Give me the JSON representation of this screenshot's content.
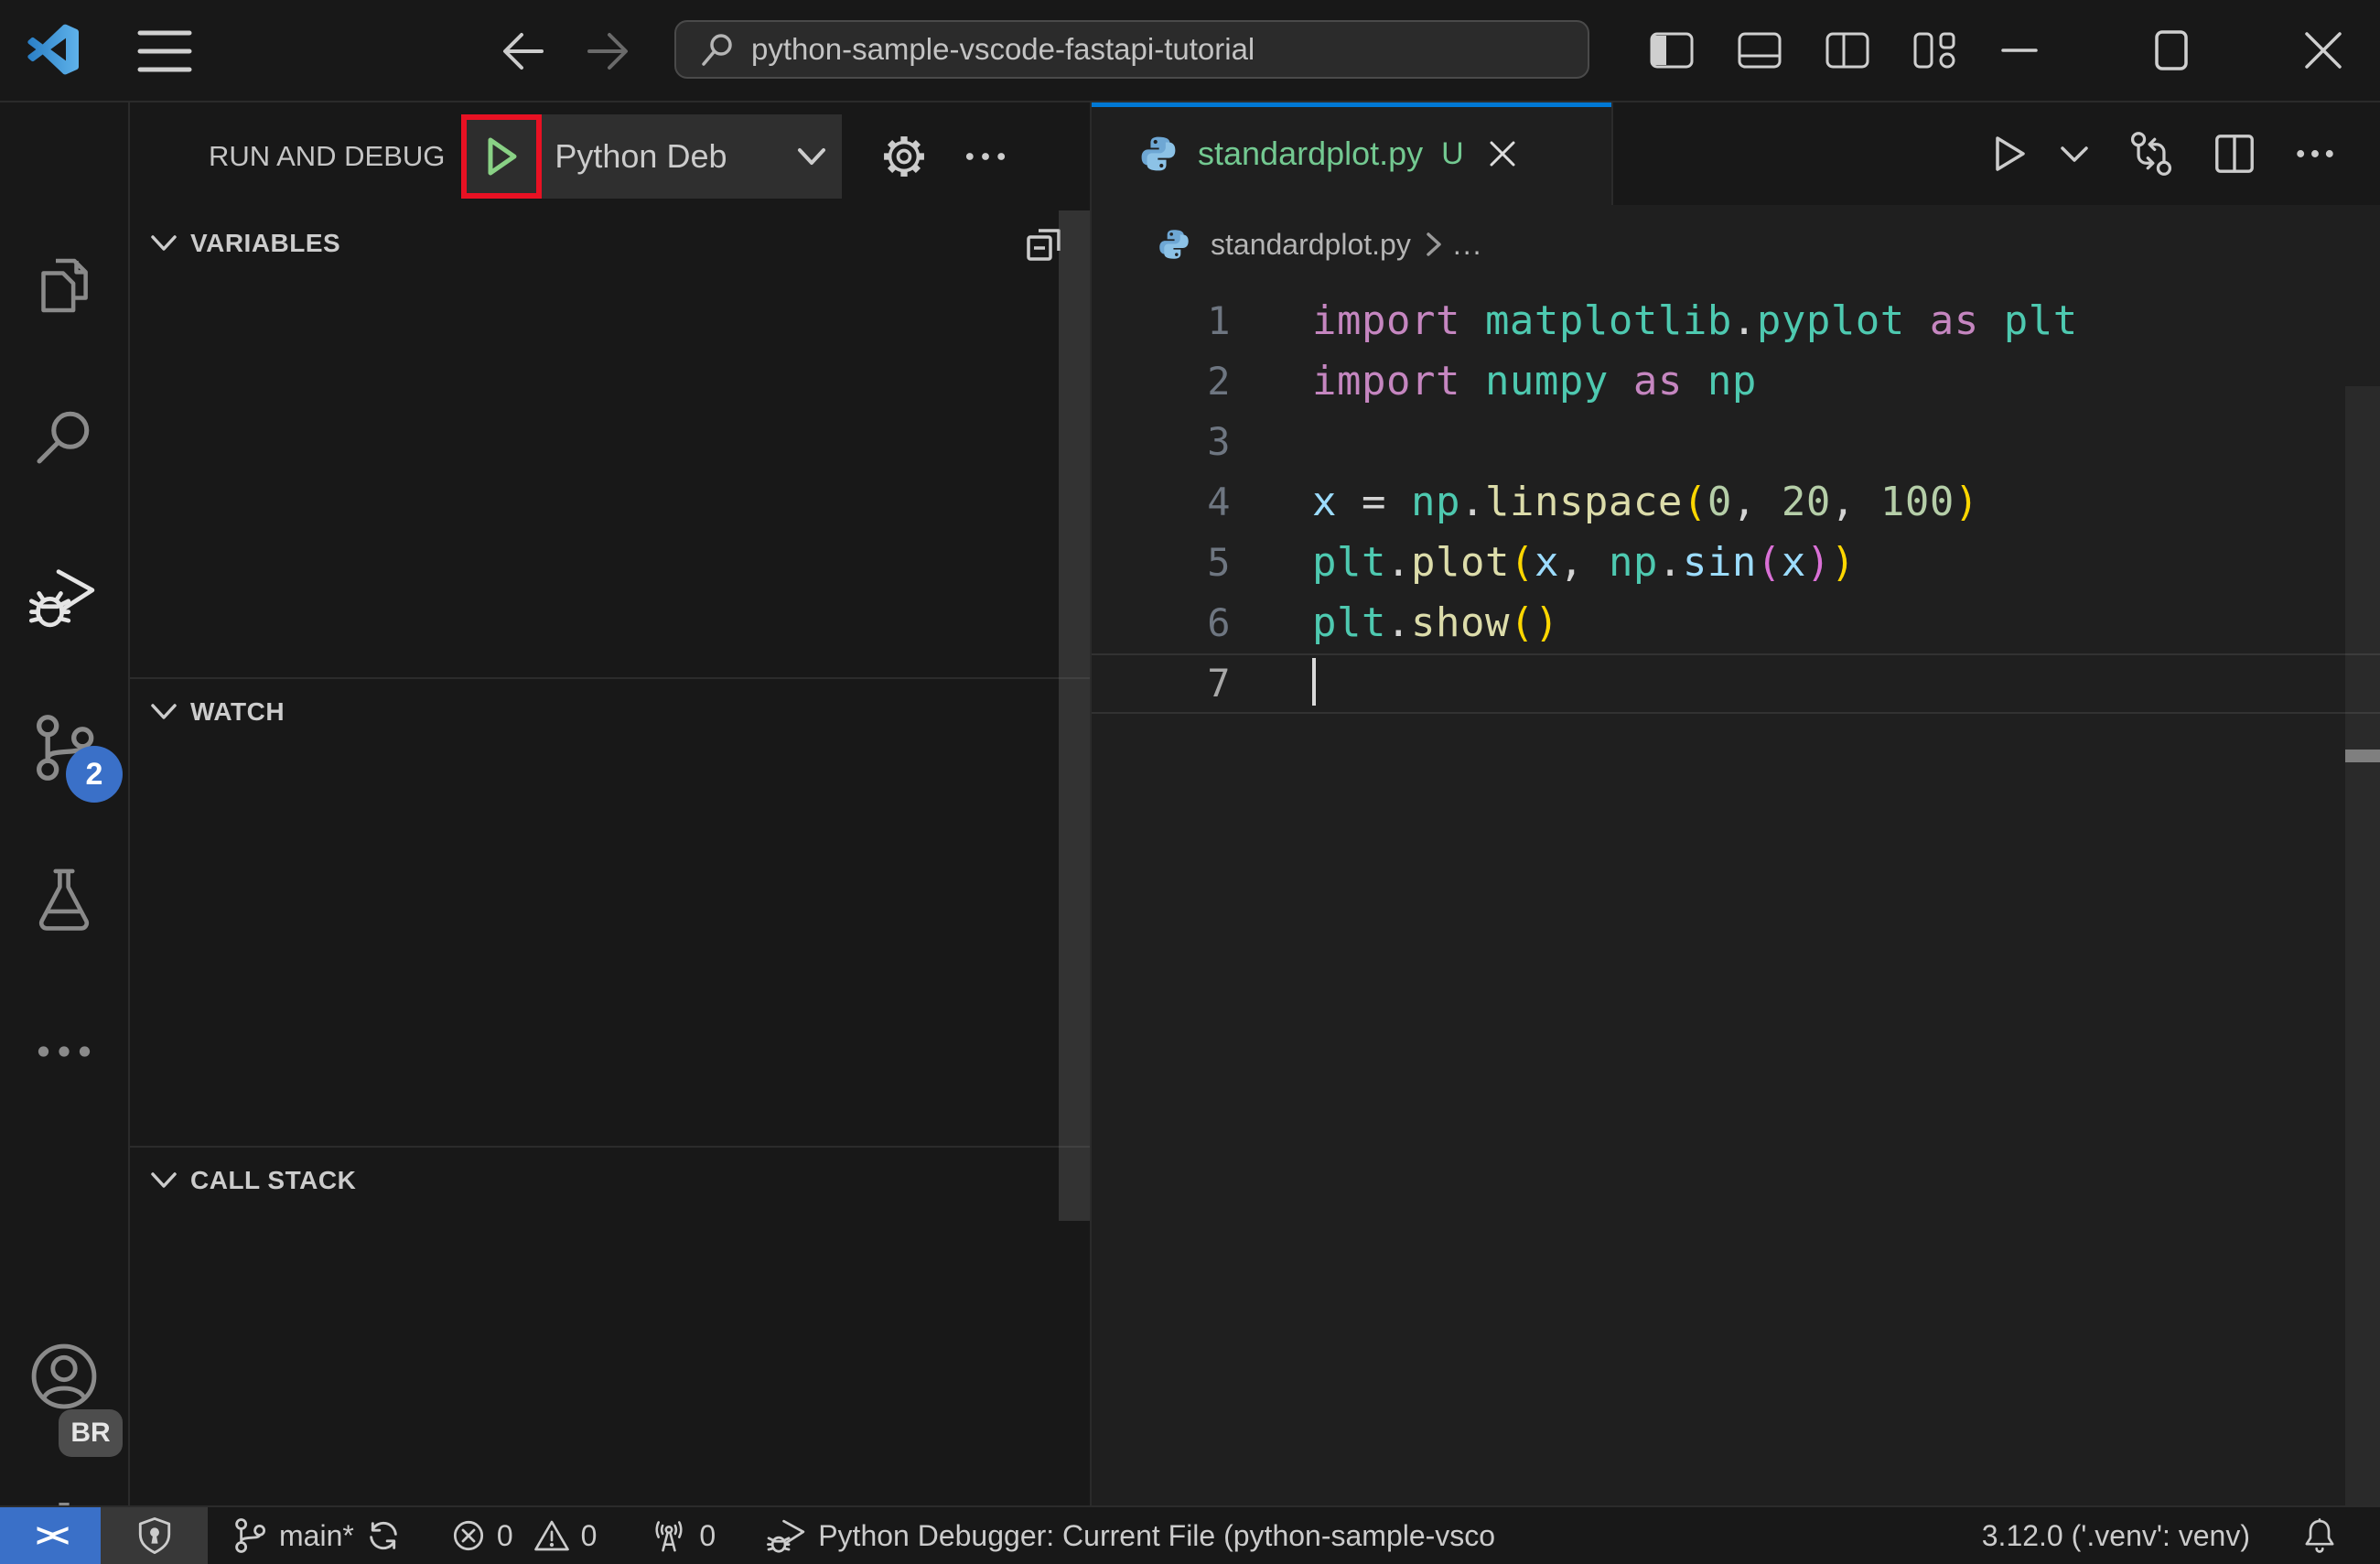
{
  "titlebar": {
    "search_value": "python-sample-vscode-fastapi-tutorial",
    "icons": [
      "vscode-logo",
      "menu",
      "arrow-left",
      "arrow-right",
      "search",
      "toggle-primary-sidebar",
      "toggle-panel",
      "toggle-secondary-sidebar",
      "customize-layout",
      "minimize",
      "maximize",
      "close"
    ]
  },
  "activitybar": {
    "items": [
      "explorer",
      "search",
      "run-and-debug",
      "source-control",
      "testing",
      "more",
      "accounts",
      "settings"
    ],
    "active_item": "run-and-debug",
    "source_control_badge": "2",
    "settings_badge": "BR"
  },
  "sidebar": {
    "title": "RUN AND DEBUG",
    "config_dropdown": "Python Deb",
    "toolbar_icons": [
      "start-debugging-play",
      "gear",
      "ellipsis"
    ],
    "sections": [
      {
        "label": "VARIABLES"
      },
      {
        "label": "WATCH"
      },
      {
        "label": "CALL STACK"
      }
    ]
  },
  "editor": {
    "tab": {
      "file": "standardplot.py",
      "dirty_badge": "U",
      "icon": "python"
    },
    "toolbar_icons": [
      "run",
      "chevron-down",
      "compare-changes",
      "split-editor",
      "ellipsis"
    ],
    "breadcrumb": {
      "file": "standardplot.py",
      "more": "..."
    },
    "cursor_line": 7,
    "code_lines": [
      [
        {
          "t": "import ",
          "s": "kw"
        },
        {
          "t": "matplotlib",
          "s": "mod"
        },
        {
          "t": ".",
          "s": "pun"
        },
        {
          "t": "pyplot",
          "s": "mod"
        },
        {
          "t": " as ",
          "s": "kw"
        },
        {
          "t": "plt",
          "s": "mod"
        }
      ],
      [
        {
          "t": "import ",
          "s": "kw"
        },
        {
          "t": "numpy",
          "s": "mod"
        },
        {
          "t": " as ",
          "s": "kw"
        },
        {
          "t": "np",
          "s": "mod"
        }
      ],
      [],
      [
        {
          "t": "x",
          "s": "var"
        },
        {
          "t": " = ",
          "s": "pun"
        },
        {
          "t": "np",
          "s": "mod"
        },
        {
          "t": ".",
          "s": "pun"
        },
        {
          "t": "linspace",
          "s": "fn"
        },
        {
          "t": "(",
          "s": "b1"
        },
        {
          "t": "0",
          "s": "num"
        },
        {
          "t": ", ",
          "s": "pun"
        },
        {
          "t": "20",
          "s": "num"
        },
        {
          "t": ", ",
          "s": "pun"
        },
        {
          "t": "100",
          "s": "num"
        },
        {
          "t": ")",
          "s": "b1"
        }
      ],
      [
        {
          "t": "plt",
          "s": "mod"
        },
        {
          "t": ".",
          "s": "pun"
        },
        {
          "t": "plot",
          "s": "fn"
        },
        {
          "t": "(",
          "s": "b1"
        },
        {
          "t": "x",
          "s": "var"
        },
        {
          "t": ", ",
          "s": "pun"
        },
        {
          "t": "np",
          "s": "mod"
        },
        {
          "t": ".",
          "s": "pun"
        },
        {
          "t": "sin",
          "s": "var"
        },
        {
          "t": "(",
          "s": "b2"
        },
        {
          "t": "x",
          "s": "var"
        },
        {
          "t": ")",
          "s": "b2"
        },
        {
          "t": ")",
          "s": "b1"
        }
      ],
      [
        {
          "t": "plt",
          "s": "mod"
        },
        {
          "t": ".",
          "s": "pun"
        },
        {
          "t": "show",
          "s": "fn"
        },
        {
          "t": "(",
          "s": "b1"
        },
        {
          "t": ")",
          "s": "b1"
        }
      ],
      []
    ]
  },
  "statusbar": {
    "remote_icon": "remote-indicator",
    "branch": "main*",
    "errors": "0",
    "warnings": "0",
    "ports": "0",
    "debug_config": "Python Debugger: Current File (python-sample-vsco",
    "python_version": "3.12.0 ('.venv': venv)",
    "icons": [
      "remote",
      "shield",
      "git-branch",
      "sync",
      "error-circle",
      "warning-triangle",
      "broadcast-tower",
      "debug",
      "bell"
    ]
  },
  "colors": {
    "accent_blue": "#0078d4",
    "remote_blue": "#3a70c8",
    "badge_blue": "#3a70c8",
    "git_green": "#73C991",
    "annotation_red": "#e81123",
    "play_green": "#89d185"
  }
}
